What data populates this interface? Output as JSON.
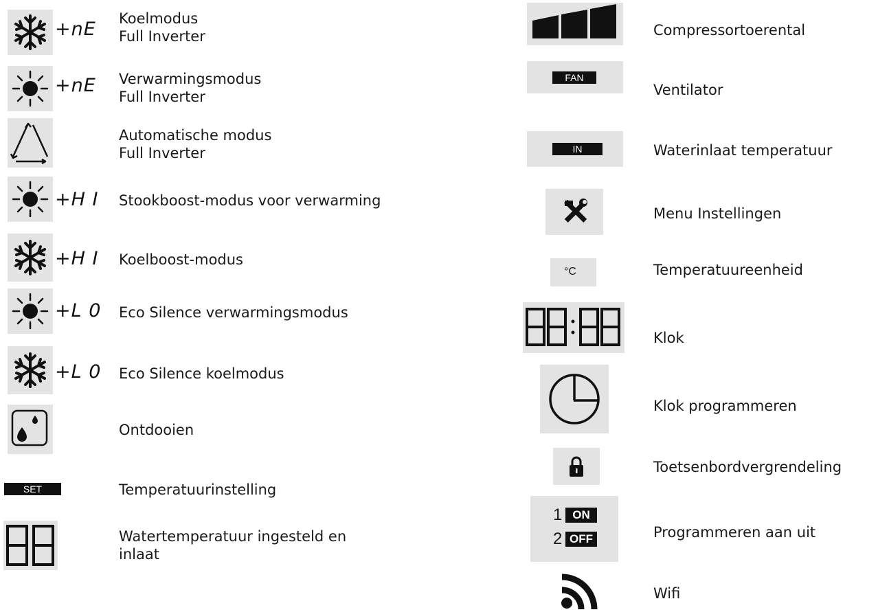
{
  "left": [
    {
      "icon": "snowflake-icon",
      "code": "+nE",
      "lines": [
        "Koelmodus",
        "Full Inverter"
      ]
    },
    {
      "icon": "sun-icon",
      "code": "+nE",
      "lines": [
        "Verwarmingsmodus",
        "Full Inverter"
      ]
    },
    {
      "icon": "auto-triangle-icon",
      "code": "",
      "lines": [
        "Automatische modus",
        "Full Inverter"
      ]
    },
    {
      "icon": "sun-icon",
      "code": "+H I",
      "lines": [
        "Stookboost-modus voor verwarming"
      ]
    },
    {
      "icon": "snowflake-icon",
      "code": "+H I",
      "lines": [
        "Koelboost-modus"
      ]
    },
    {
      "icon": "sun-icon",
      "code": "+L 0",
      "lines": [
        "Eco Silence verwarmingsmodus"
      ]
    },
    {
      "icon": "snowflake-icon",
      "code": "+L 0",
      "lines": [
        "Eco Silence koelmodus"
      ]
    },
    {
      "icon": "defrost-drops-icon",
      "code": "",
      "lines": [
        "Ontdooien"
      ]
    },
    {
      "icon": "set-tag-icon",
      "tag": "SET",
      "lines": [
        "Temperatuurinstelling"
      ]
    },
    {
      "icon": "segment-digits-icon",
      "lines": [
        "Watertemperatuur ingesteld en",
        "inlaat"
      ]
    }
  ],
  "right": [
    {
      "icon": "compressor-bars-icon",
      "label": "Compressortoerental"
    },
    {
      "icon": "fan-tag-icon",
      "tag": "FAN",
      "label": "Ventilator"
    },
    {
      "icon": "in-tag-icon",
      "tag": "IN",
      "label": "Waterinlaat temperatuur"
    },
    {
      "icon": "tools-icon",
      "label": "Menu Instellingen"
    },
    {
      "icon": "celsius-icon",
      "unit": "°C",
      "label": "Temperatuureenheid"
    },
    {
      "icon": "clock-digits-icon",
      "label": "Klok"
    },
    {
      "icon": "clock-icon",
      "label": "Klok programmeren"
    },
    {
      "icon": "lock-icon",
      "label": "Toetsenbordvergrendeling"
    },
    {
      "icon": "on-off-icon",
      "on_num": "1",
      "on": "ON",
      "off_num": "2",
      "off": "OFF",
      "label": "Programmeren aan uit"
    },
    {
      "icon": "wifi-icon",
      "label": "Wifi"
    }
  ]
}
